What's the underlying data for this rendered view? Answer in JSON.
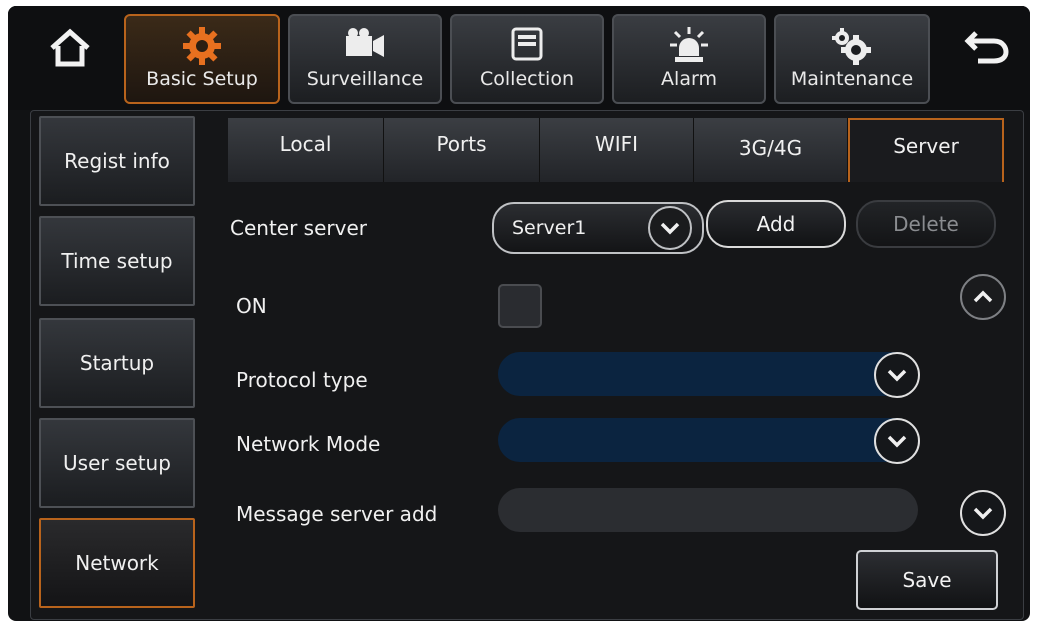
{
  "top_nav": {
    "home_icon": "home-icon",
    "back_icon": "back-arrow-icon",
    "tabs": [
      {
        "label": "Basic Setup",
        "icon": "gear-icon",
        "active": true
      },
      {
        "label": "Surveillance",
        "icon": "camera-icon",
        "active": false
      },
      {
        "label": "Collection",
        "icon": "folder-icon",
        "active": false
      },
      {
        "label": "Alarm",
        "icon": "alarm-light-icon",
        "active": false
      },
      {
        "label": "Maintenance",
        "icon": "gears-icon",
        "active": false
      }
    ]
  },
  "sidebar": {
    "items": [
      {
        "label": "Regist info",
        "active": false
      },
      {
        "label": "Time setup",
        "active": false
      },
      {
        "label": "Startup",
        "active": false
      },
      {
        "label": "User setup",
        "active": false
      },
      {
        "label": "Network",
        "active": true
      }
    ]
  },
  "subtabs": [
    {
      "label": "Local",
      "active": false
    },
    {
      "label": "Ports",
      "active": false
    },
    {
      "label": "WIFI",
      "active": false
    },
    {
      "label": "3G/4G",
      "active": false
    },
    {
      "label": "Server",
      "active": true
    }
  ],
  "form": {
    "center_server_label": "Center server",
    "center_server_value": "Server1",
    "add_label": "Add",
    "delete_label": "Delete",
    "on_label": "ON",
    "on_checked": false,
    "protocol_label": "Protocol type",
    "protocol_value": "",
    "network_mode_label": "Network Mode",
    "network_mode_value": "",
    "message_server_label": "Message server add",
    "message_server_value": "",
    "save_label": "Save"
  },
  "colors": {
    "accent": "#b8631c",
    "field_blue": "#0b2440",
    "field_gray": "#2b2d31"
  }
}
